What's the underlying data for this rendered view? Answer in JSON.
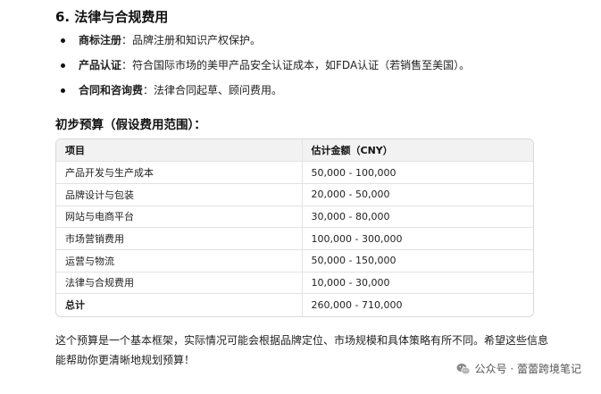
{
  "section": {
    "title": "6. 法律与合规费用",
    "items": [
      {
        "term": "商标注册",
        "desc": "：品牌注册和知识产权保护。"
      },
      {
        "term": "产品认证",
        "desc": "：符合国际市场的美甲产品安全认证成本，如FDA认证（若销售至美国）。"
      },
      {
        "term": "合同和咨询费",
        "desc": "：法律合同起草、顾问费用。"
      }
    ]
  },
  "budget": {
    "title": "初步预算（假设费用范围）：",
    "headers": [
      "项目",
      "估计金额（CNY）"
    ],
    "rows": [
      [
        "产品开发与生产成本",
        "50,000 - 100,000"
      ],
      [
        "品牌设计与包装",
        "20,000 - 50,000"
      ],
      [
        "网站与电商平台",
        "30,000 - 80,000"
      ],
      [
        "市场营销费用",
        "100,000 - 300,000"
      ],
      [
        "运营与物流",
        "50,000 - 150,000"
      ],
      [
        "法律与合规费用",
        "10,000 - 30,000"
      ],
      [
        "总计",
        "260,000 - 710,000"
      ]
    ]
  },
  "footer": {
    "text": "这个预算是一个基本框架，实际情况可能会根据品牌定位、市场规模和具体策略有所不同。希望这些信息能帮助你更清晰地规划预算！"
  },
  "watermark": {
    "text": "公众号 · 蕾蕾跨境笔记",
    "icon": "wechat-icon"
  }
}
